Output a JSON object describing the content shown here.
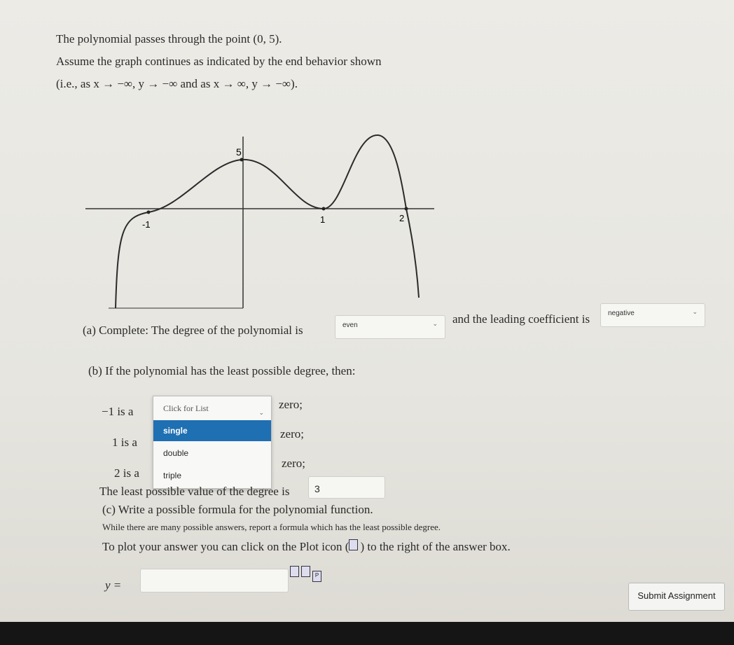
{
  "problem": {
    "line1": "The polynomial passes through the point (0, 5).",
    "line2": "Assume the graph continues as indicated by the end behavior shown",
    "line3": "(i.e., as x → −∞, y → −∞ and as x → ∞, y → −∞)."
  },
  "graph": {
    "x_tick_labels": [
      "-1",
      "1",
      "2"
    ],
    "y_tick_labels": [
      "5"
    ],
    "key_points": [
      {
        "x": -1,
        "y": 0
      },
      {
        "x": 0,
        "y": 5
      },
      {
        "x": 1,
        "y": 0
      },
      {
        "x": 2,
        "y": 0
      }
    ]
  },
  "part_a": {
    "prefix": "(a) Complete: The degree of the polynomial is",
    "degree_select": "even",
    "middle": "and the leading coefficient is",
    "coefficient_select": "negative"
  },
  "part_b": {
    "heading": "(b) If the polynomial has the least possible degree, then:",
    "rows": [
      {
        "label": "−1 is a",
        "suffix": "zero;"
      },
      {
        "label": "1 is a",
        "suffix": "zero;"
      },
      {
        "label": "2 is a",
        "suffix": "zero;"
      }
    ],
    "dropdown_placeholder": "Click for List",
    "dropdown_options": [
      "single",
      "double",
      "triple"
    ],
    "highlighted_option": "single",
    "least_degree_label": "The least possible value of the degree is",
    "least_degree_value": "3"
  },
  "part_c": {
    "heading": "(c) Write a possible formula for the polynomial function.",
    "note": "While there are many possible answers, report a formula which has the least possible degree.",
    "plot_hint_before": "To plot your answer you can click on the Plot icon (",
    "plot_hint_after": ") to the right of the answer box.",
    "y_label": "y =",
    "answer_value": ""
  },
  "submit_label": "Submit Assignment",
  "colors": {
    "highlight": "#1f6fb3",
    "curve": "#2b2b2b"
  }
}
